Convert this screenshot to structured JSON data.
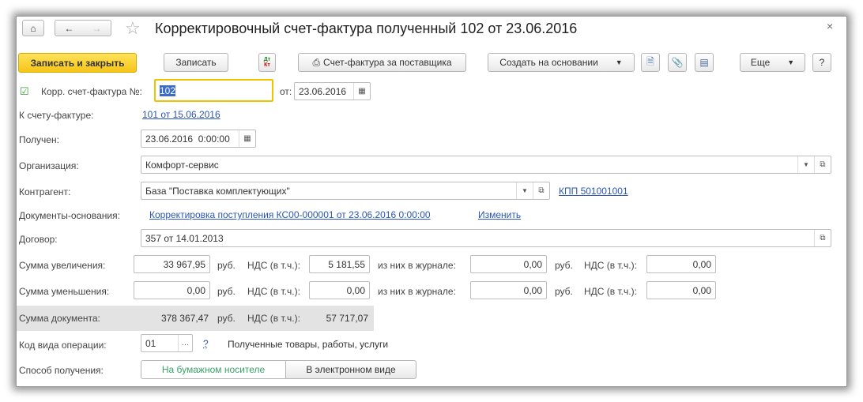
{
  "title": "Корректировочный счет-фактура полученный 102 от 23.06.2016",
  "toolbar": {
    "save_close": "Записать и закрыть",
    "save": "Записать",
    "dtkt_top": "Дт",
    "dtkt_bot": "Кт",
    "invoice_supplier": "Счет-фактура за поставщика",
    "create_based": "Создать на основании",
    "more": "Еще",
    "help": "?"
  },
  "form": {
    "corr_label": "Корр. счет-фактура №:",
    "corr_number": "102",
    "from_label": "от:",
    "from_date": "23.06.2016",
    "to_invoice_label": "К счету-фактуре:",
    "to_invoice_link": "101 от 15.06.2016",
    "received_label": "Получен:",
    "received_value": "23.06.2016  0:00:00",
    "org_label": "Организация:",
    "org_value": "Комфорт-сервис",
    "contractor_label": "Контрагент:",
    "contractor_value": "База \"Поставка комплектующих\"",
    "kpp_link": "КПП 501001001",
    "docs_label": "Документы-основания:",
    "docs_link": "Корректировка поступления КС00-000001 от 23.06.2016 0:00:00",
    "docs_change": "Изменить",
    "contract_label": "Договор:",
    "contract_value": "357 от 14.01.2013",
    "inc_label": "Сумма увеличения:",
    "inc_sum": "33 967,95",
    "inc_vat": "5 181,55",
    "inc_journal": "0,00",
    "inc_journal_vat": "0,00",
    "dec_label": "Сумма уменьшения:",
    "dec_sum": "0,00",
    "dec_vat": "0,00",
    "dec_journal": "0,00",
    "dec_journal_vat": "0,00",
    "rub": "руб.",
    "vat_label": "НДС (в т.ч.):",
    "journal_label": "из них в журнале:",
    "doc_label": "Сумма документа:",
    "doc_sum": "378 367,47",
    "doc_vat": "57 717,07",
    "op_label": "Код вида операции:",
    "op_code": "01",
    "op_help": "?",
    "op_desc": "Полученные товары, работы, услуги",
    "method_label": "Способ получения:",
    "method_paper": "На бумажном носителе",
    "method_electronic": "В электронном виде"
  }
}
